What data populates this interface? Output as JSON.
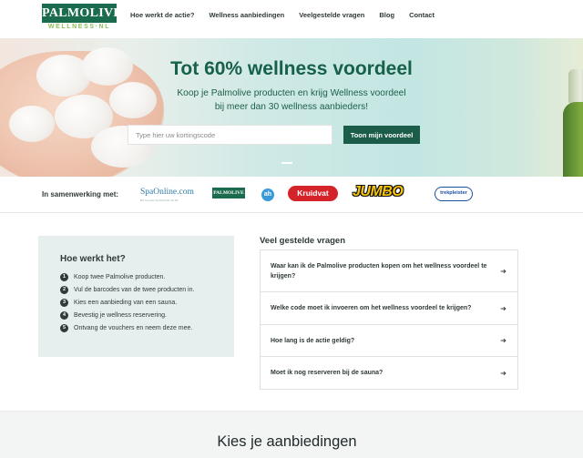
{
  "header": {
    "logo_main": "PALMOLIVE",
    "logo_sub": "WELLNESS·NL",
    "nav": [
      "Hoe werkt de actie?",
      "Wellness aanbiedingen",
      "Veelgestelde vragen",
      "Blog",
      "Contact"
    ]
  },
  "hero": {
    "title": "Tot 60% wellness voordeel",
    "subtitle_line1": "Koop je Palmolive producten en krijg Wellness voordeel",
    "subtitle_line2": "bij meer dan 30 wellness aanbieders!",
    "search_placeholder": "Type hier uw kortingscode",
    "search_button": "Toon mijn voordeel"
  },
  "partners": {
    "label": "In samenwerking met:",
    "logos": {
      "spaonline": "SpaOnline.com",
      "spaonline_sub": "Het Grootste Spa Platform van NL",
      "palmolive": "PALMOLIVE",
      "ah": "ah",
      "kruidvat": "Kruidvat",
      "jumbo": "JUMBO",
      "trekpleister": "trekpleister"
    }
  },
  "how": {
    "title": "Hoe werkt het?",
    "steps": [
      {
        "num": "1",
        "text": "Koop twee Palmolive producten."
      },
      {
        "num": "2",
        "text": "Vul de barcodes van de twee producten in."
      },
      {
        "num": "3",
        "text": "Kies een aanbieding van een sauna."
      },
      {
        "num": "4",
        "text": "Bevestig je wellness reservering."
      },
      {
        "num": "5",
        "text": "Ontvang de vouchers en neem deze mee."
      }
    ]
  },
  "faq": {
    "title": "Veel gestelde vragen",
    "items": [
      {
        "q": "Waar kan ik de Palmolive producten kopen om het wellness voordeel te krijgen?"
      },
      {
        "q": "Welke code moet ik invoeren om het wellness voordeel te krijgen?"
      },
      {
        "q": "Hoe lang is de actie geldig?"
      },
      {
        "q": "Moet ik nog reserveren bij de sauna?"
      }
    ],
    "arrow": "➔"
  },
  "offers": {
    "title": "Kies je aanbiedingen"
  },
  "colors": {
    "brand_green": "#1b6b4e",
    "button_green": "#1b5d49",
    "panel_bg": "#e7efee"
  }
}
